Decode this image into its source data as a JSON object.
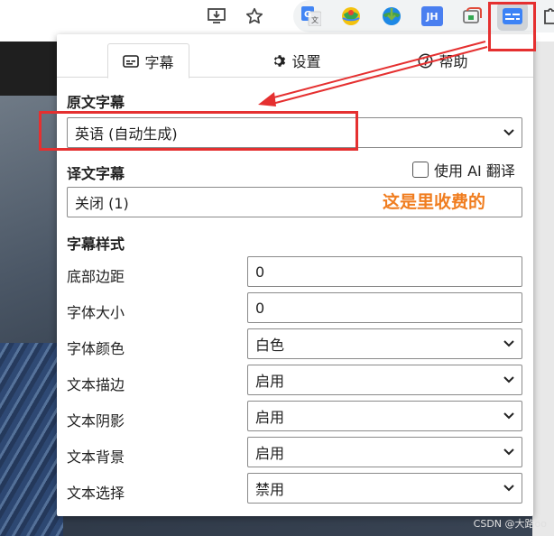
{
  "extensions": {
    "jh_label": "JH"
  },
  "popup": {
    "tabs": [
      {
        "label": "字幕",
        "icon": "subtitles-icon",
        "active": true
      },
      {
        "label": "设置",
        "icon": "gear-icon",
        "active": false
      },
      {
        "label": "帮助",
        "icon": "help-icon",
        "active": false
      }
    ],
    "original_subtitle": {
      "title": "原文字幕",
      "selected": "英语 (自动生成)"
    },
    "translated_subtitle": {
      "title": "译文字幕",
      "ai_translate_label": "使用 AI 翻译",
      "ai_translate_checked": false,
      "selected": "关闭 (1)"
    },
    "style": {
      "title": "字幕样式",
      "rows": [
        {
          "label": "底部边距",
          "value": "0",
          "kind": "input"
        },
        {
          "label": "字体大小",
          "value": "0",
          "kind": "input"
        },
        {
          "label": "字体颜色",
          "value": "白色",
          "kind": "select"
        },
        {
          "label": "文本描边",
          "value": "启用",
          "kind": "select"
        },
        {
          "label": "文本阴影",
          "value": "启用",
          "kind": "select"
        },
        {
          "label": "文本背景",
          "value": "启用",
          "kind": "select"
        },
        {
          "label": "文本选择",
          "value": "禁用",
          "kind": "select"
        }
      ]
    }
  },
  "annotation": {
    "note": "这是里收费的",
    "color": "#f07d1f",
    "box_color": "#e53030"
  },
  "watermark": "CSDN @大路oo"
}
